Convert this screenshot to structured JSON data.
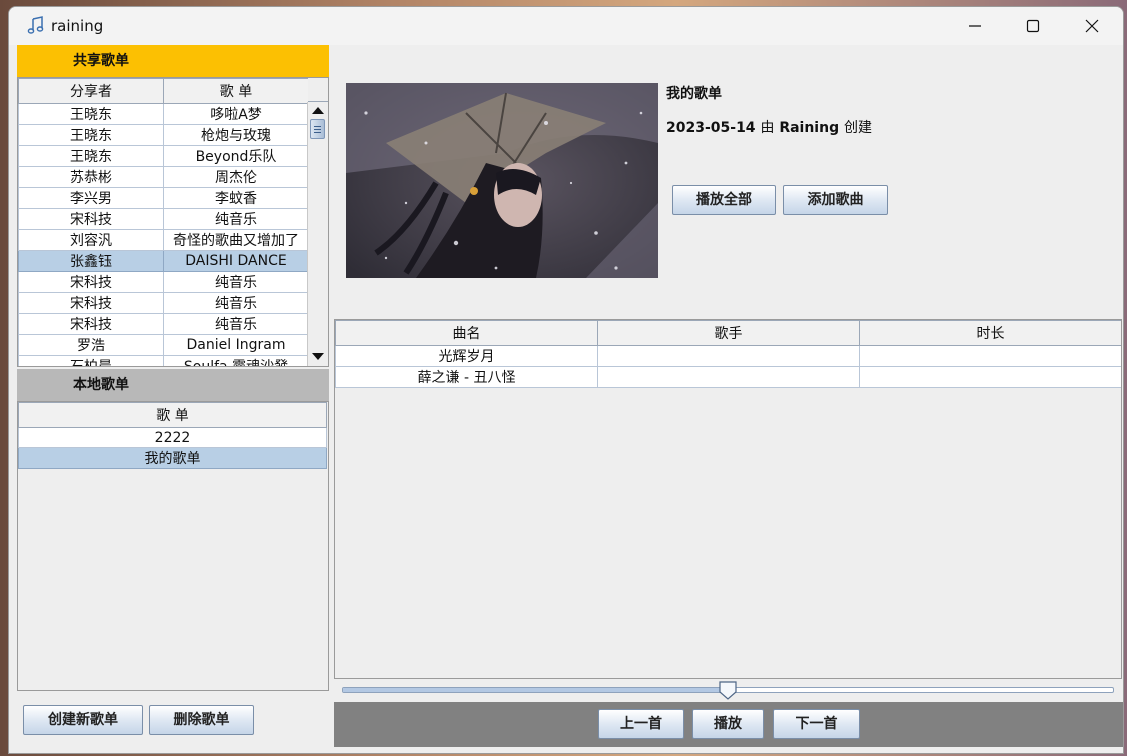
{
  "window": {
    "title": "raining"
  },
  "shared": {
    "header": "共享歌单",
    "columns": [
      "分享者",
      "歌 单"
    ],
    "rows": [
      [
        "王晓东",
        "哆啦A梦"
      ],
      [
        "王晓东",
        "枪炮与玫瑰"
      ],
      [
        "王晓东",
        "Beyond乐队"
      ],
      [
        "苏恭彬",
        "周杰伦"
      ],
      [
        "李兴男",
        "李蚊香"
      ],
      [
        "宋科技",
        "纯音乐"
      ],
      [
        "刘容汎",
        "奇怪的歌曲又增加了"
      ],
      [
        "张鑫钰",
        "DAISHI DANCE"
      ],
      [
        "宋科技",
        "纯音乐"
      ],
      [
        "宋科技",
        "纯音乐"
      ],
      [
        "宋科技",
        "纯音乐"
      ],
      [
        "罗浩",
        "Daniel Ingram"
      ],
      [
        "石柏晨",
        "Soulfa 靈魂沙發"
      ],
      [
        "",
        ""
      ]
    ],
    "selected_row": 7
  },
  "local": {
    "header": "本地歌单",
    "column": "歌 单",
    "rows": [
      "2222",
      "我的歌单"
    ],
    "selected_row": 1
  },
  "left_buttons": {
    "create": "创建新歌单",
    "delete": "删除歌单"
  },
  "playlist": {
    "name": "我的歌单",
    "meta_date": "2023-05-14",
    "meta_by": "由",
    "meta_user": "Raining",
    "meta_action": "创建",
    "play_all": "播放全部",
    "add_song": "添加歌曲"
  },
  "songs": {
    "columns": [
      "曲名",
      "歌手",
      "时长"
    ],
    "rows": [
      [
        "光辉岁月",
        "",
        ""
      ],
      [
        "薛之谦 - 丑八怪",
        "",
        ""
      ]
    ]
  },
  "player": {
    "progress": 0.5,
    "prev": "上一首",
    "play": "播放",
    "next": "下一首"
  },
  "colors": {
    "shared_header_bg": "#fcc002",
    "local_header_bg": "#b8b8b8",
    "selection": "#b8cfe5",
    "bottom_bar": "#818181"
  }
}
